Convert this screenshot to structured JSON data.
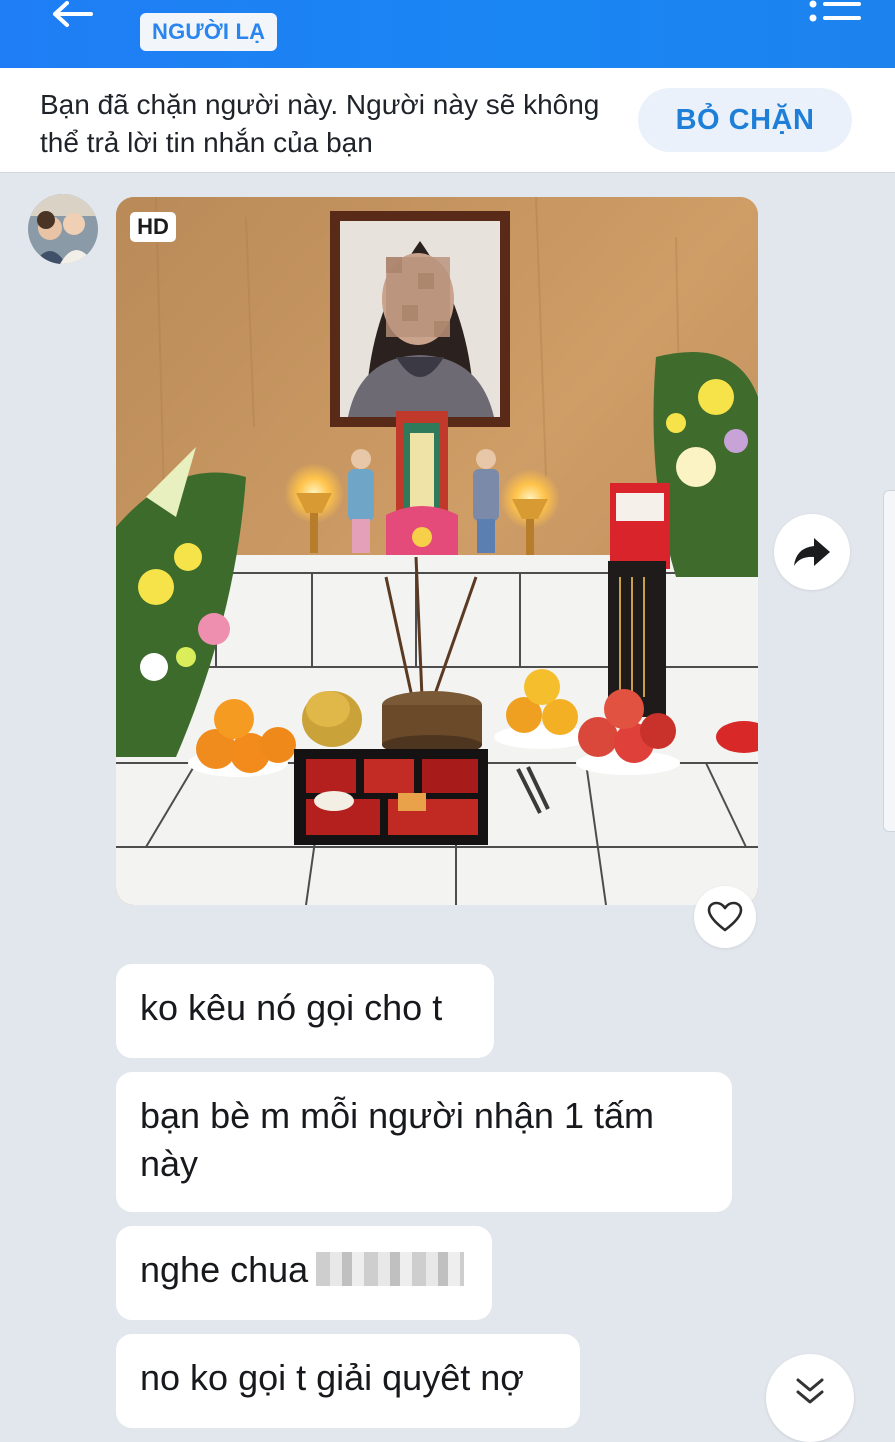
{
  "header": {
    "badge_label": "NGƯỜI LẠ",
    "icons": [
      "back-arrow-icon",
      "menu-list-icon"
    ]
  },
  "block_banner": {
    "message": "Bạn đã chặn người này. Người này sẽ không thể trả lời tin nhắn của bạn",
    "unblock_label": "BỎ CHẶN"
  },
  "photo_message": {
    "quality_badge": "HD",
    "actions": [
      "forward-icon",
      "heart-icon"
    ]
  },
  "messages": [
    {
      "text": "ko kêu nó gọi cho t"
    },
    {
      "text": "bạn bè m mỗi người nhận 1 tấm này"
    },
    {
      "text": "nghe chua"
    },
    {
      "text": "no ko gọi t giải quyêt nợ"
    }
  ],
  "colors": {
    "header_blue": "#1a86f3",
    "accent_blue": "#1e7fd9",
    "chat_background": "#e2e7ed",
    "bubble": "#ffffff"
  }
}
